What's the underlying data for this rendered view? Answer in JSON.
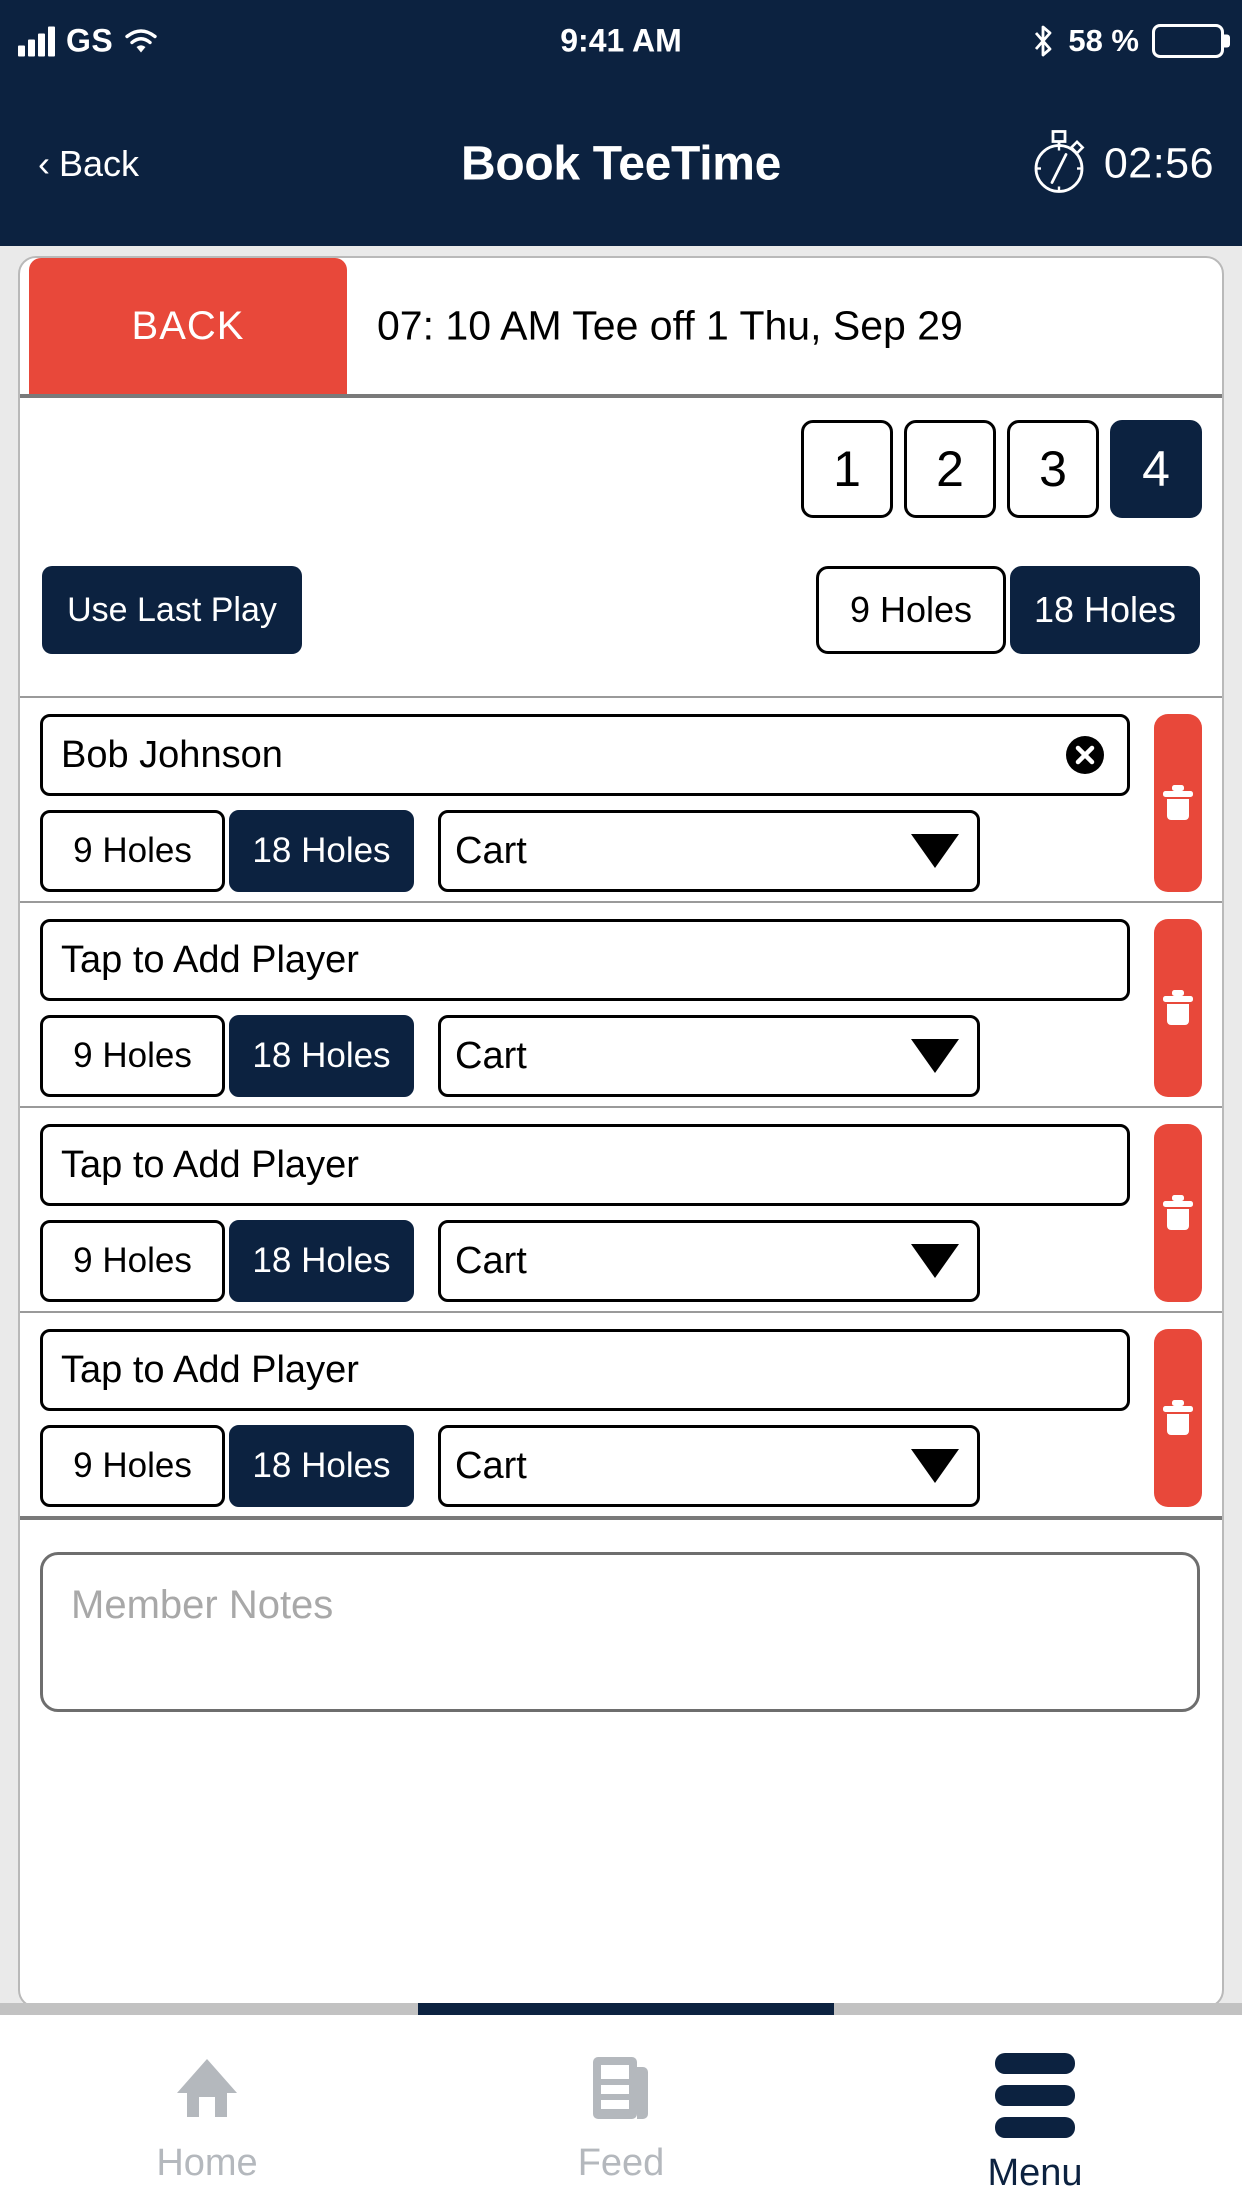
{
  "status_bar": {
    "carrier": "GS",
    "time": "9:41 AM",
    "battery_percent": "58 %",
    "signal_icon": "signal-bars-icon",
    "wifi_icon": "wifi-icon",
    "bluetooth_icon": "bluetooth-icon",
    "battery_icon": "battery-icon"
  },
  "nav_bar": {
    "back_label": "Back",
    "title": "Book TeeTime",
    "timer": "02:56",
    "timer_icon": "stopwatch-icon"
  },
  "subheader": {
    "back_button": "BACK",
    "teetime_text": "07: 10 AM Tee off 1 Thu, Sep 29"
  },
  "player_count": {
    "options": [
      "1",
      "2",
      "3",
      "4"
    ],
    "selected": "4"
  },
  "options_row": {
    "use_last_play": "Use Last Play",
    "holes_options": [
      "9 Holes",
      "18 Holes"
    ],
    "holes_selected": "18 Holes"
  },
  "players": [
    {
      "name": "Bob Johnson",
      "is_placeholder": false,
      "clear_icon": "clear-circle-icon",
      "holes_options": [
        "9 Holes",
        "18 Holes"
      ],
      "holes_selected": "18 Holes",
      "cart": "Cart",
      "delete_icon": "trash-icon"
    },
    {
      "name": "Tap to Add Player",
      "is_placeholder": true,
      "holes_options": [
        "9 Holes",
        "18 Holes"
      ],
      "holes_selected": "18 Holes",
      "cart": "Cart",
      "delete_icon": "trash-icon"
    },
    {
      "name": "Tap to Add Player",
      "is_placeholder": true,
      "holes_options": [
        "9 Holes",
        "18 Holes"
      ],
      "holes_selected": "18 Holes",
      "cart": "Cart",
      "delete_icon": "trash-icon"
    },
    {
      "name": "Tap to Add Player",
      "is_placeholder": true,
      "holes_options": [
        "9 Holes",
        "18 Holes"
      ],
      "holes_selected": "18 Holes",
      "cart": "Cart",
      "delete_icon": "trash-icon"
    }
  ],
  "notes": {
    "placeholder": "Member Notes",
    "value": ""
  },
  "tab_bar": {
    "items": [
      {
        "label": "Home",
        "icon": "home-icon",
        "active": false
      },
      {
        "label": "Feed",
        "icon": "feed-icon",
        "active": false
      },
      {
        "label": "Menu",
        "icon": "hamburger-icon",
        "active": true
      }
    ]
  },
  "colors": {
    "navy": "#0C2240",
    "red": "#E8483A",
    "page_bg": "#EAEAEA",
    "inactive_gray": "#B4B8BD"
  }
}
